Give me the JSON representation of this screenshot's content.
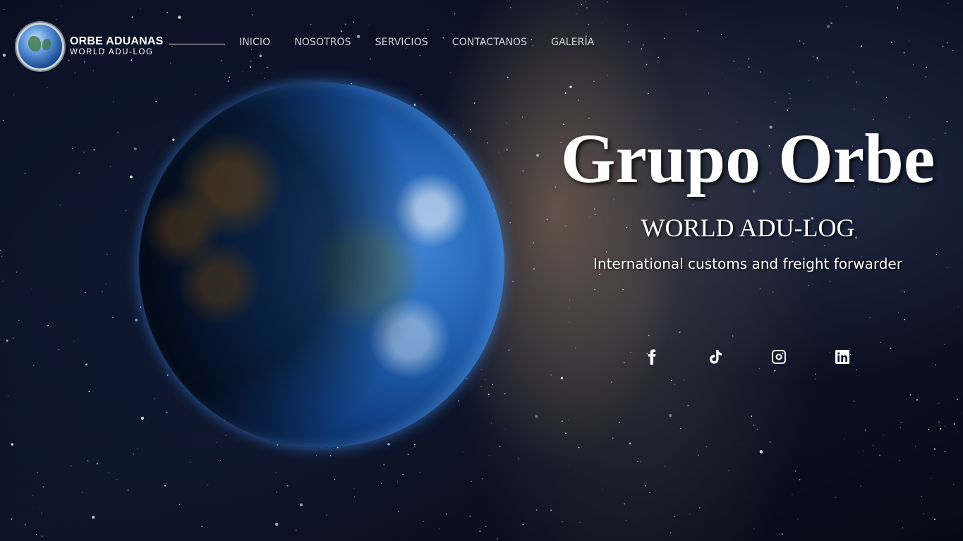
{
  "brand": {
    "title": "ORBE ADUANAS",
    "subtitle": "WORLD ADU-LOG",
    "icon": "globe-logo-icon"
  },
  "nav": {
    "items": [
      {
        "label": "INICIO"
      },
      {
        "label": "NOSOTROS"
      },
      {
        "label": "SERVICIOS"
      },
      {
        "label": "CONTACTANOS"
      },
      {
        "label": "GALERÍA"
      }
    ]
  },
  "hero": {
    "title": "Grupo Orbe",
    "subtitle": "WORLD ADU-LOG",
    "tagline": "International customs and freight forwarder"
  },
  "social": [
    {
      "icon": "facebook-icon"
    },
    {
      "icon": "tiktok-icon"
    },
    {
      "icon": "instagram-icon"
    },
    {
      "icon": "linkedin-icon"
    }
  ],
  "colors": {
    "text": "#ffffff",
    "nav_text": "#cfd3da",
    "background": "#0b1226"
  }
}
